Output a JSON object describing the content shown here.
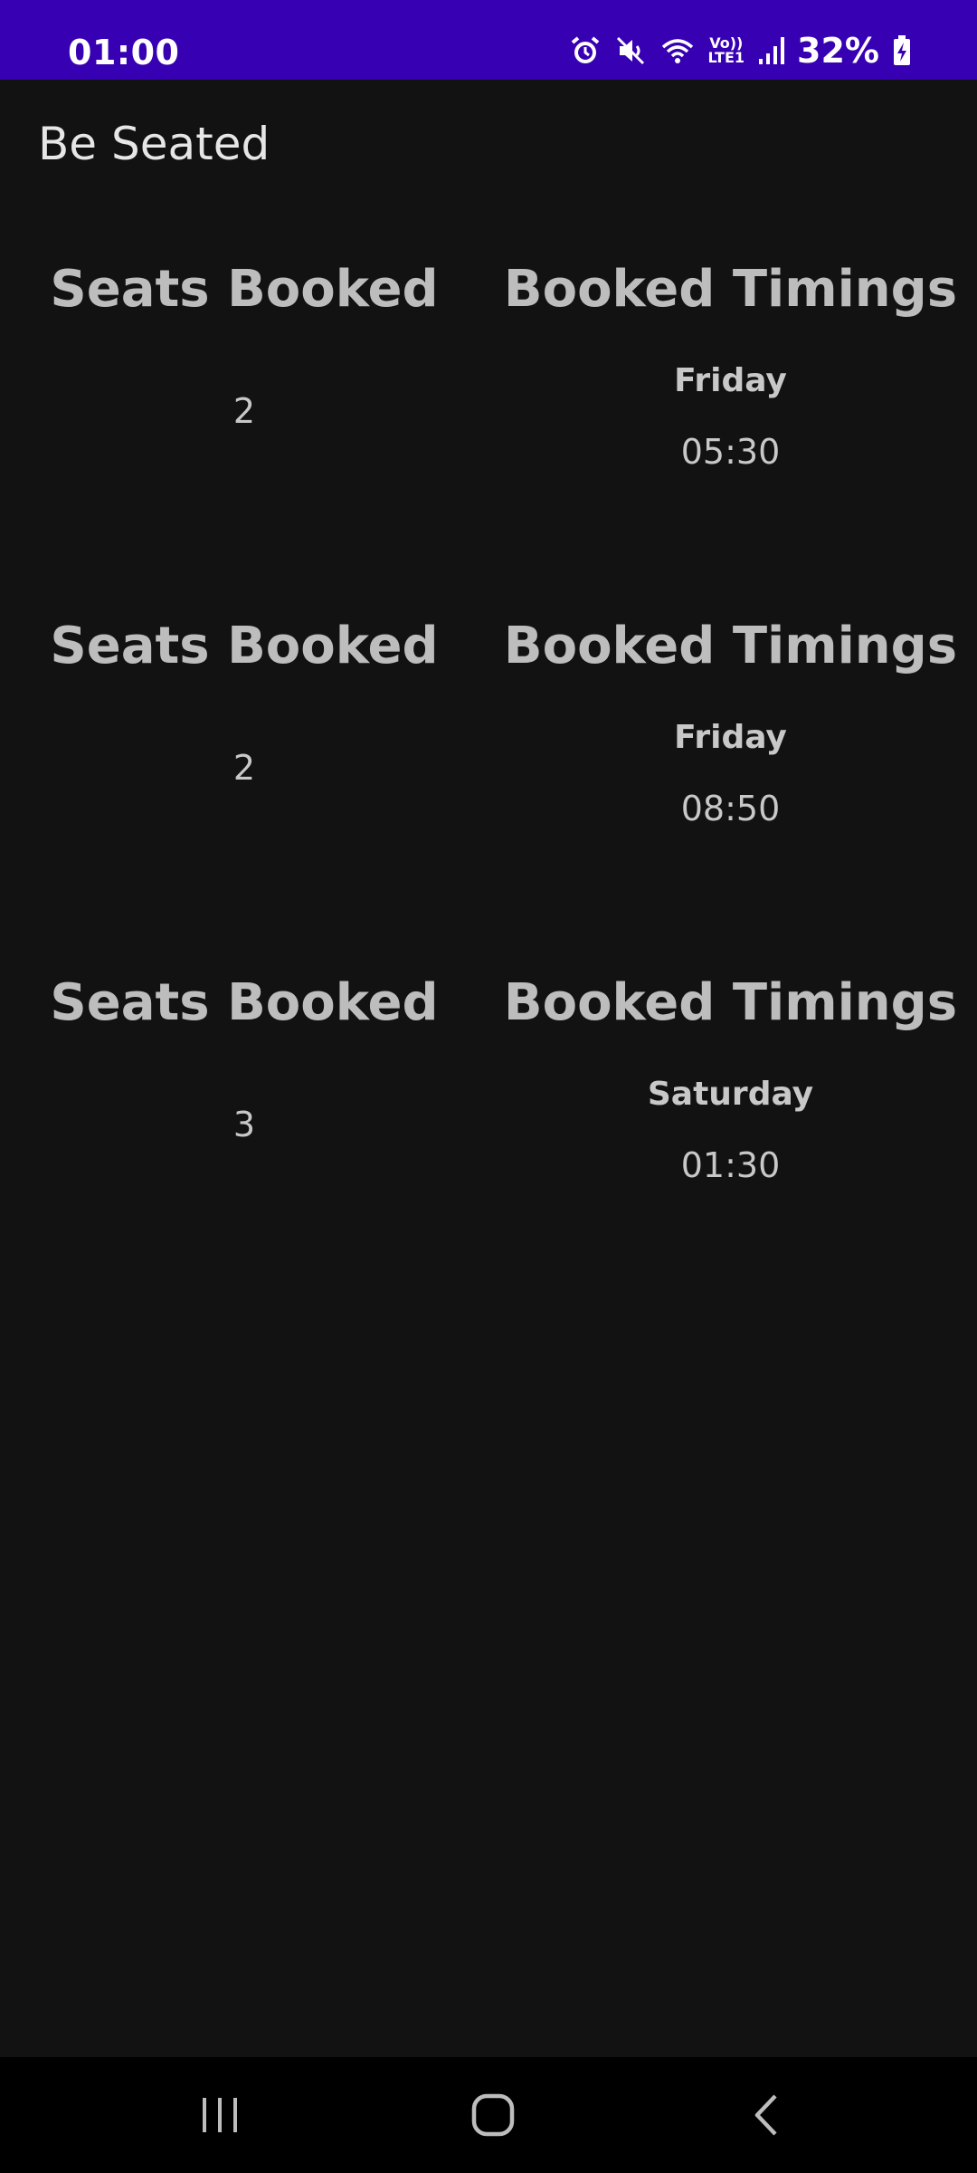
{
  "status_bar": {
    "time": "01:00",
    "network_label_top": "Vo))",
    "network_label_bottom": "LTE1",
    "battery": "32%",
    "icons": [
      "alarm-icon",
      "mute-icon",
      "wifi-icon",
      "signal-icon",
      "battery-charging-icon"
    ],
    "background_color": "#3700B3"
  },
  "app": {
    "title": "Be Seated"
  },
  "bookings": [
    {
      "seats_label": "Seats Booked",
      "seats": "2",
      "timings_label": "Booked Timings",
      "day": "Friday",
      "time": "05:30"
    },
    {
      "seats_label": "Seats Booked",
      "seats": "2",
      "timings_label": "Booked Timings",
      "day": "Friday",
      "time": "08:50"
    },
    {
      "seats_label": "Seats Booked",
      "seats": "3",
      "timings_label": "Booked Timings",
      "day": "Saturday",
      "time": "01:30"
    }
  ],
  "nav_bar": {
    "icons": [
      "recents-icon",
      "home-icon",
      "back-icon"
    ]
  }
}
